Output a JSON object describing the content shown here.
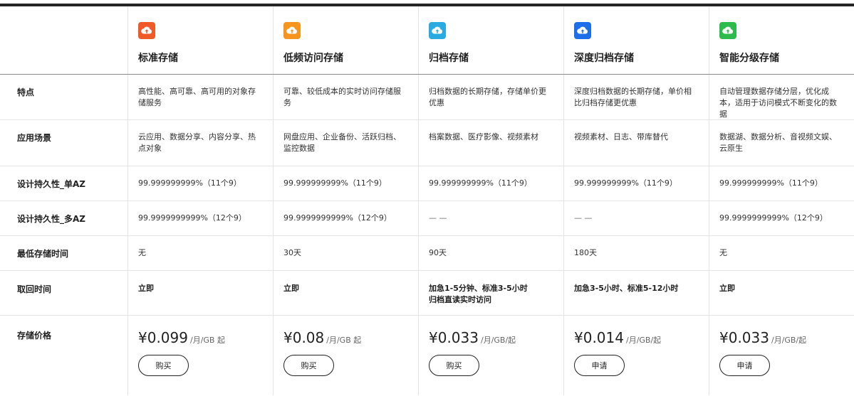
{
  "products": [
    {
      "name": "标准存储",
      "icon": "cloud-upload-icon",
      "color": "#f05a28"
    },
    {
      "name": "低频访问存储",
      "icon": "cloud-upload-icon",
      "color": "#f7941d"
    },
    {
      "name": "归档存储",
      "icon": "cloud-upload-icon",
      "color": "#29abe2"
    },
    {
      "name": "深度归档存储",
      "icon": "cloud-upload-icon",
      "color": "#1c6fe8"
    },
    {
      "name": "智能分级存储",
      "icon": "cloud-upload-icon",
      "color": "#2dbb4e"
    }
  ],
  "rows": {
    "feature": {
      "label": "特点",
      "values": [
        "高性能、高可靠、高可用的对象存储服务",
        "可靠、较低成本的实时访问存储服务",
        "归档数据的长期存储，存储单价更优惠",
        "深度归档数据的长期存储，单价相比归档存储更优惠",
        "自动管理数据存储分层，优化成本，适用于访问模式不断变化的数据"
      ]
    },
    "scene": {
      "label": "应用场景",
      "values": [
        "云应用、数据分享、内容分享、热点对象",
        "网盘应用、企业备份、活跃归档、监控数据",
        "档案数据、医疗影像、视频素材",
        "视频素材、日志、带库替代",
        "数据湖、数据分析、音视频文娱、云原生"
      ]
    },
    "durability_single": {
      "label": "设计持久性_单AZ",
      "values": [
        "99.999999999%（11个9）",
        "99.999999999%（11个9）",
        "99.999999999%（11个9）",
        "99.999999999%（11个9）",
        "99.999999999%（11个9）"
      ]
    },
    "durability_multi": {
      "label": "设计持久性_多AZ",
      "values": [
        "99.9999999999%（12个9）",
        "99.9999999999%（12个9）",
        "— —",
        "— —",
        "99.9999999999%（12个9）"
      ]
    },
    "min_time": {
      "label": "最低存储时间",
      "values": [
        "无",
        "30天",
        "90天",
        "180天",
        "无"
      ]
    },
    "retrieval": {
      "label": "取回时间",
      "values": [
        [
          "立即"
        ],
        [
          "立即"
        ],
        [
          "加急1-5分钟、标准3-5小时",
          "归档直读实时访问"
        ],
        [
          "加急3-5小时、标准5-12小时"
        ],
        [
          "立即"
        ]
      ]
    },
    "price": {
      "label": "存储价格",
      "items": [
        {
          "value": "¥0.099",
          "unit": "/月/GB 起",
          "button": "购买"
        },
        {
          "value": "¥0.08",
          "unit": "/月/GB 起",
          "button": "购买"
        },
        {
          "value": "¥0.033",
          "unit": "/月/GB/起",
          "button": "购买"
        },
        {
          "value": "¥0.014",
          "unit": "/月/GB/起",
          "button": "申请"
        },
        {
          "value": "¥0.033",
          "unit": "/月/GB/起",
          "button": "申请"
        }
      ]
    }
  }
}
